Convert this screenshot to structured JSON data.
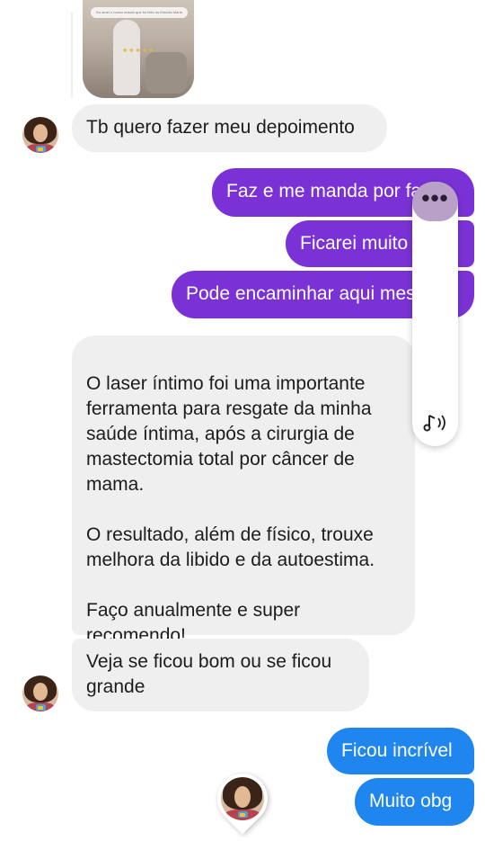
{
  "messages": [
    {
      "id": "m1",
      "side": "in",
      "text": "Tb quero fazer meu depoimento"
    },
    {
      "id": "m2",
      "side": "out",
      "text": "Faz e me manda por favor"
    },
    {
      "id": "m3",
      "side": "out",
      "text": "Ficarei muito feliz"
    },
    {
      "id": "m4",
      "side": "out",
      "text": "Pode encaminhar aqui mesmo"
    },
    {
      "id": "m5",
      "side": "in",
      "text": "O laser íntimo foi uma importante ferramenta para resgate da minha saúde íntima, após a cirurgia de mastectomia total por câncer de mama.\n\nO resultado, além de físico, trouxe melhora da libido e da autoestima.\n\nFaço anualmente e super recomendo!"
    },
    {
      "id": "m6",
      "side": "in",
      "text": "Veja se ficou bom ou se ficou grande"
    },
    {
      "id": "m7",
      "side": "out",
      "text": "Ficou incrível"
    },
    {
      "id": "m8",
      "side": "out",
      "text": "Muito obg"
    }
  ],
  "floating_menu": {
    "dots": "•••",
    "icon": "music-note-icon"
  },
  "image_preview": {
    "caption": "Eu amei o nosso ensaio que foi feito no Estúdio Maria"
  },
  "colors": {
    "purple": "#7a32d6",
    "blue": "#1e86ee",
    "incoming": "#efefef"
  }
}
